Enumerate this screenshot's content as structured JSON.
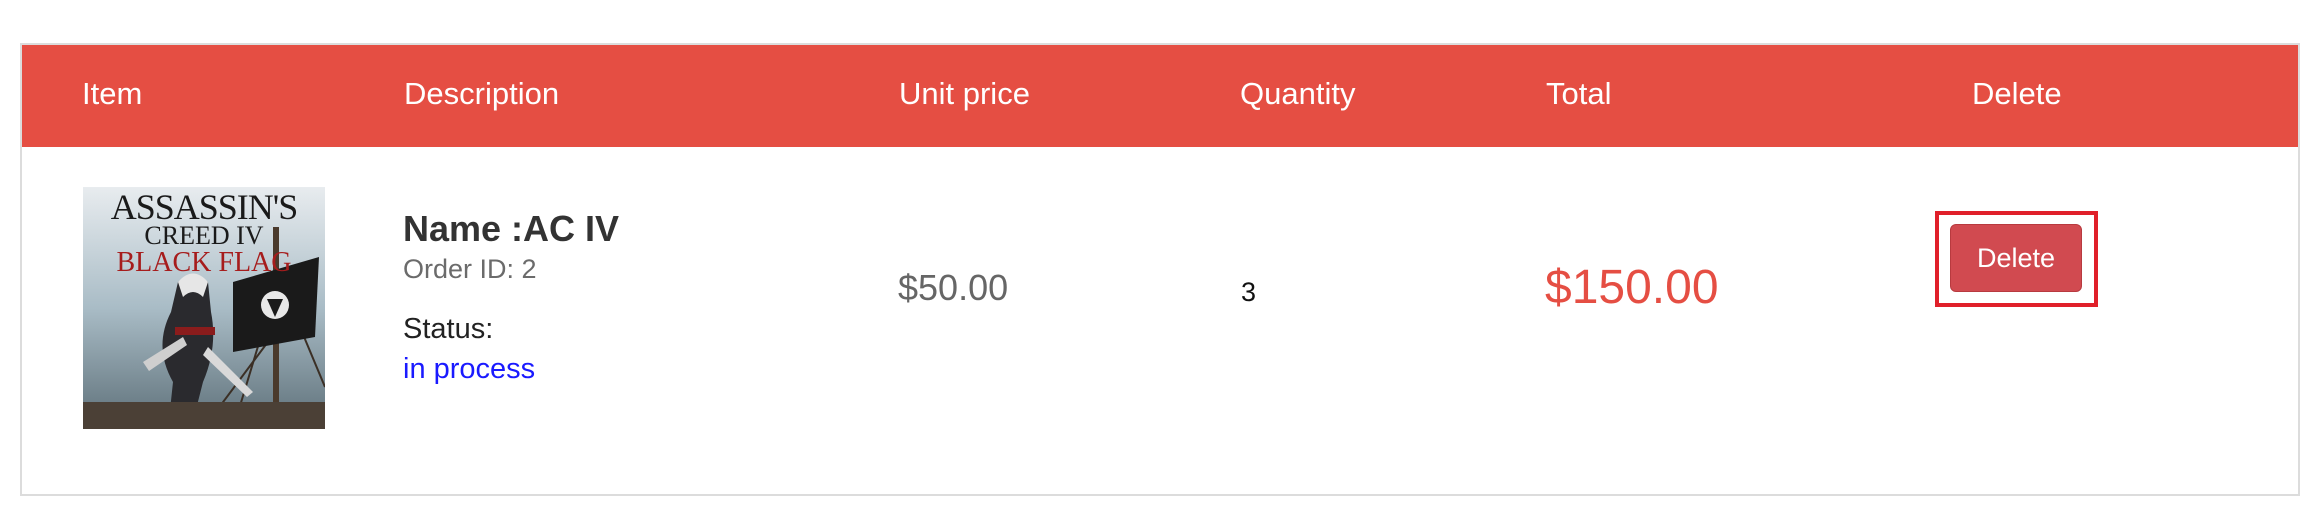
{
  "table": {
    "headers": {
      "item": "Item",
      "description": "Description",
      "unit_price": "Unit price",
      "quantity": "Quantity",
      "total": "Total",
      "delete": "Delete"
    },
    "rows": [
      {
        "image": {
          "title_line1": "ASSASSIN'S",
          "title_line2": "CREED IV",
          "title_line3": "BLACK FLAG"
        },
        "name": "Name :AC IV",
        "order_id": "Order ID: 2",
        "status_label": "Status:",
        "status_value": "in process",
        "unit_price": "$50.00",
        "quantity": "3",
        "total": "$150.00",
        "delete_label": "Delete"
      }
    ]
  },
  "colors": {
    "header_bg": "#e54e43",
    "total_text": "#e54e43",
    "status_link": "#1a1aff",
    "delete_button": "#d14a50",
    "highlight_border": "#e0202a"
  }
}
